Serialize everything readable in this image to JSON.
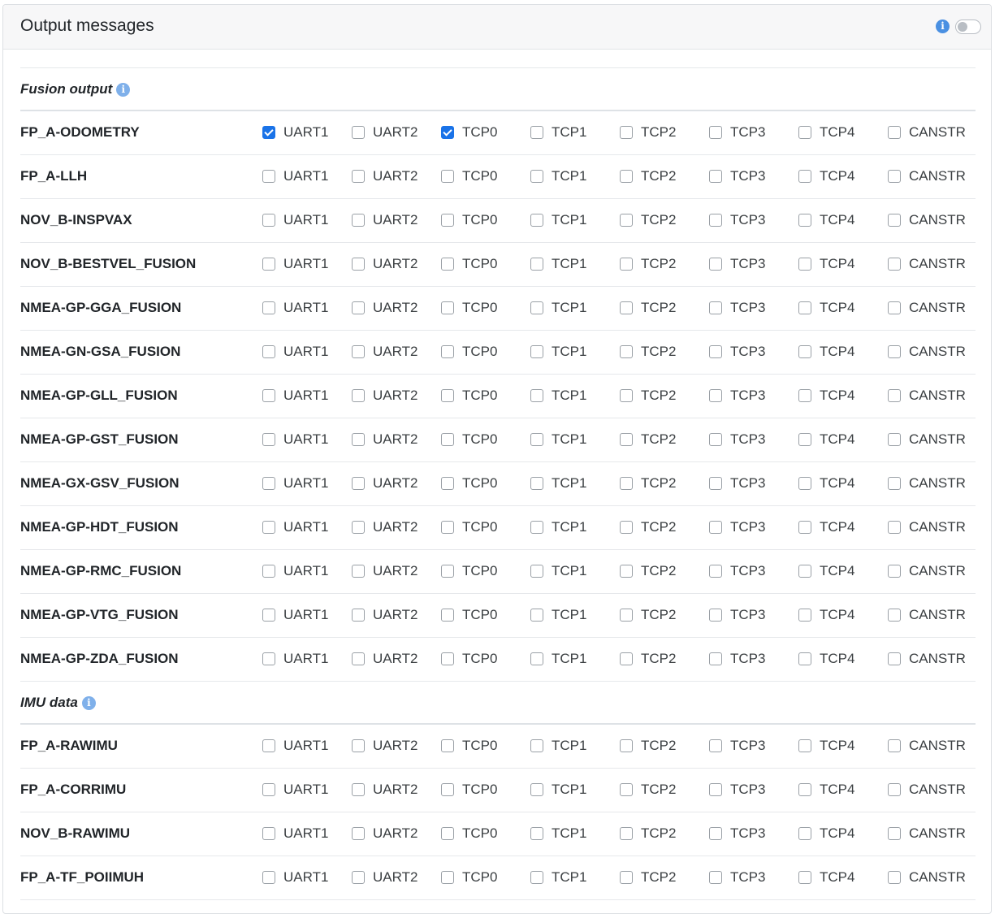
{
  "panel": {
    "title": "Output messages",
    "info_icon": "info-icon",
    "toggle_on": false
  },
  "channels": [
    "UART1",
    "UART2",
    "TCP0",
    "TCP1",
    "TCP2",
    "TCP3",
    "TCP4",
    "CANSTR"
  ],
  "sections": [
    {
      "title": "Fusion output",
      "messages": [
        {
          "name": "FP_A-ODOMETRY",
          "checked": [
            "UART1",
            "TCP0"
          ]
        },
        {
          "name": "FP_A-LLH",
          "checked": []
        },
        {
          "name": "NOV_B-INSPVAX",
          "checked": []
        },
        {
          "name": "NOV_B-BESTVEL_FUSION",
          "checked": []
        },
        {
          "name": "NMEA-GP-GGA_FUSION",
          "checked": []
        },
        {
          "name": "NMEA-GN-GSA_FUSION",
          "checked": []
        },
        {
          "name": "NMEA-GP-GLL_FUSION",
          "checked": []
        },
        {
          "name": "NMEA-GP-GST_FUSION",
          "checked": []
        },
        {
          "name": "NMEA-GX-GSV_FUSION",
          "checked": []
        },
        {
          "name": "NMEA-GP-HDT_FUSION",
          "checked": []
        },
        {
          "name": "NMEA-GP-RMC_FUSION",
          "checked": []
        },
        {
          "name": "NMEA-GP-VTG_FUSION",
          "checked": []
        },
        {
          "name": "NMEA-GP-ZDA_FUSION",
          "checked": []
        }
      ]
    },
    {
      "title": "IMU data",
      "messages": [
        {
          "name": "FP_A-RAWIMU",
          "checked": []
        },
        {
          "name": "FP_A-CORRIMU",
          "checked": []
        },
        {
          "name": "NOV_B-RAWIMU",
          "checked": []
        },
        {
          "name": "FP_A-TF_POIIMUH",
          "checked": []
        }
      ]
    }
  ],
  "colors": {
    "accent": "#1a73e8",
    "info": "#4a90e2"
  }
}
